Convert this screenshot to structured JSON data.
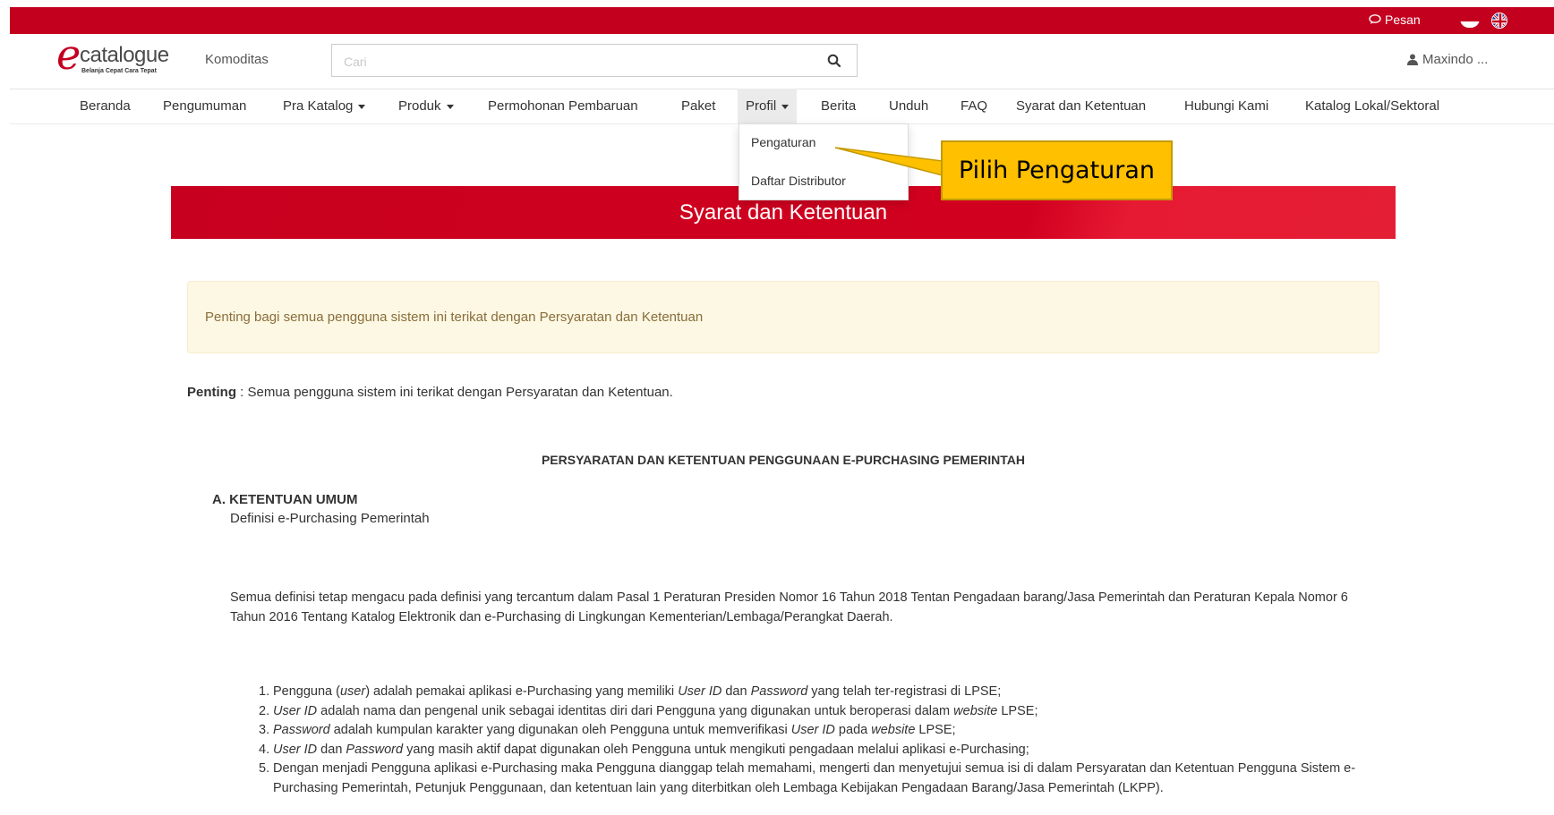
{
  "topbar": {
    "pesan_label": "Pesan",
    "accent_color": "#c4001f"
  },
  "header": {
    "logo_word": "catalogue",
    "logo_tagline": "Belanja Cepat Cara Tepat",
    "komoditas_label": "Komoditas",
    "search_placeholder": "Cari",
    "user_name": "Maxindo ..."
  },
  "nav": {
    "items": [
      {
        "label": "Beranda"
      },
      {
        "label": "Pengumuman"
      },
      {
        "label": "Pra Katalog"
      },
      {
        "label": "Produk"
      },
      {
        "label": "Permohonan Pembaruan"
      },
      {
        "label": "Paket"
      },
      {
        "label": "Profil"
      },
      {
        "label": "Berita"
      },
      {
        "label": "Unduh"
      },
      {
        "label": "FAQ"
      },
      {
        "label": "Syarat dan Ketentuan"
      },
      {
        "label": "Hubungi Kami"
      },
      {
        "label": "Katalog Lokal/Sektoral"
      }
    ],
    "profil_dropdown": [
      {
        "label": "Pengaturan"
      },
      {
        "label": "Daftar Distributor"
      }
    ]
  },
  "callout": {
    "text": "Pilih Pengaturan",
    "color": "#ffc000"
  },
  "banner": {
    "title": "Syarat dan Ketentuan"
  },
  "alert": {
    "text": "Penting bagi semua pengguna sistem ini terikat dengan Persyaratan dan Ketentuan"
  },
  "content": {
    "penting_bold": "Penting",
    "penting_text": " : Semua pengguna sistem ini terikat dengan Persyaratan dan Ketentuan.",
    "doc_heading": "PERSYARATAN DAN KETENTUAN PENGGUNAAN E-PURCHASING PEMERINTAH",
    "section_a_title": "A. KETENTUAN UMUM",
    "section_a_subtitle": "Definisi e-Purchasing Pemerintah",
    "paragraph": "Semua definisi tetap mengacu pada definisi yang tercantum dalam Pasal 1 Peraturan Presiden Nomor 16 Tahun 2018 Tentan Pengadaan barang/Jasa Pemerintah dan Peraturan Kepala Nomor 6 Tahun 2016 Tentang Katalog Elektronik dan e-Purchasing di Lingkungan Kementerian/Lembaga/Perangkat Daerah.",
    "list": [
      {
        "num": "1.",
        "p1": "Pengguna (",
        "i1": "user",
        "p2": ") adalah pemakai aplikasi e-Purchasing yang memiliki ",
        "i2": "User ID",
        "p3": " dan ",
        "i3": "Password",
        "p4": " yang telah ter-registrasi di LPSE;"
      },
      {
        "num": "2.",
        "p1": "",
        "i1": "User ID",
        "p2": " adalah nama dan pengenal unik sebagai identitas diri dari Pengguna yang digunakan untuk beroperasi dalam ",
        "i2": "website",
        "p3": " LPSE;",
        "i3": "",
        "p4": ""
      },
      {
        "num": "3.",
        "p1": "",
        "i1": "Password",
        "p2": " adalah kumpulan karakter yang digunakan oleh Pengguna untuk memverifikasi ",
        "i2": "User ID",
        "p3": " pada ",
        "i3": "website",
        "p4": " LPSE;"
      },
      {
        "num": "4.",
        "p1": "",
        "i1": "User ID",
        "p2": " dan ",
        "i2": "Password",
        "p3": " yang masih aktif dapat digunakan oleh Pengguna untuk mengikuti pengadaan melalui aplikasi e-Purchasing;",
        "i3": "",
        "p4": ""
      },
      {
        "num": "5.",
        "p1": "Dengan menjadi Pengguna aplikasi e-Purchasing maka Pengguna dianggap telah memahami, mengerti dan menyetujui semua isi di dalam Persyaratan dan Ketentuan Pengguna Sistem e-Purchasing Pemerintah, Petunjuk Penggunaan, dan ketentuan lain yang diterbitkan oleh Lembaga Kebijakan Pengadaan Barang/Jasa Pemerintah (LKPP).",
        "i1": "",
        "p2": "",
        "i2": "",
        "p3": "",
        "i3": "",
        "p4": ""
      }
    ]
  }
}
